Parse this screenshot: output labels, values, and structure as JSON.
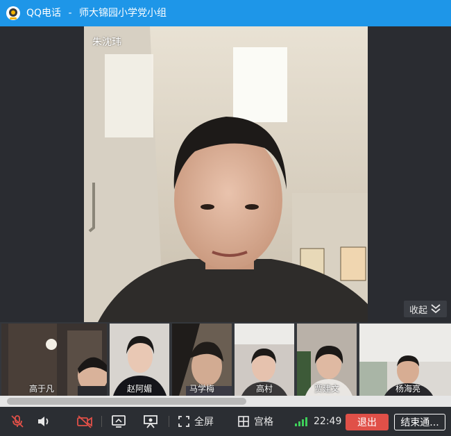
{
  "window": {
    "app_name": "QQ电话",
    "separator": "-",
    "group_name": "师大锦园小学党小组"
  },
  "speaker": {
    "name": "朱沈玮"
  },
  "collapse": {
    "label": "收起",
    "icon": "double-chevron-down-icon"
  },
  "participants": [
    {
      "name": "高于凡"
    },
    {
      "name": "赵阿媚"
    },
    {
      "name": "马学梅"
    },
    {
      "name": "高村"
    },
    {
      "name": "贾建文"
    },
    {
      "name": "杨海亮"
    }
  ],
  "toolbar": {
    "mic_icon": "mic-muted-icon",
    "speaker_icon": "speaker-icon",
    "camera_icon": "camera-off-icon",
    "screenshare_icon": "screen-share-icon",
    "whiteboard_icon": "presentation-icon",
    "fullscreen_label": "全屏",
    "grid_label": "宫格",
    "signal_icon": "signal-bars-icon",
    "signal_color": "#3ecf5a",
    "time": "22:49",
    "quit_label": "退出",
    "end_label": "结束通..."
  },
  "colors": {
    "titlebar": "#1e96e8",
    "quit_button": "#e05048"
  }
}
